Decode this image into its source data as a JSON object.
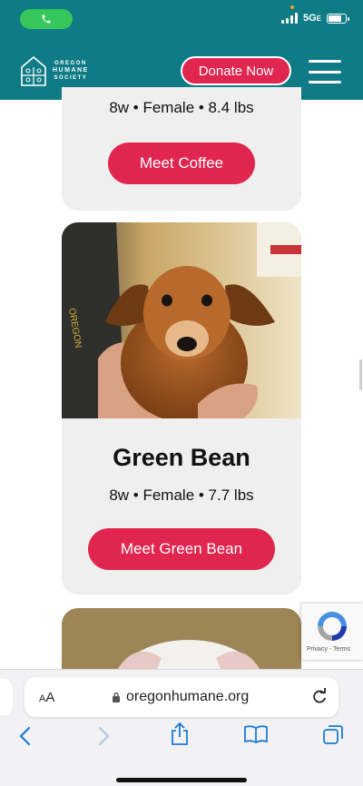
{
  "status": {
    "network": "5G",
    "network_suffix": "E"
  },
  "header": {
    "logo_lines": [
      "OREGON",
      "HUMANE",
      "SOCIETY"
    ],
    "donate_label": "Donate Now"
  },
  "cards": [
    {
      "meta": "8w • Female • 8.4 lbs",
      "button": "Meet Coffee"
    },
    {
      "name": "Green Bean",
      "meta": "8w • Female • 7.7 lbs",
      "button": "Meet Green Bean"
    }
  ],
  "recaptcha": {
    "links": "Privacy - Terms"
  },
  "safari": {
    "aa_small": "A",
    "aa_large": "A",
    "url": "oregonhumane.org"
  },
  "colors": {
    "brand_teal": "#0e7b86",
    "accent_pink": "#e0254f",
    "card_bg": "#efefef"
  }
}
